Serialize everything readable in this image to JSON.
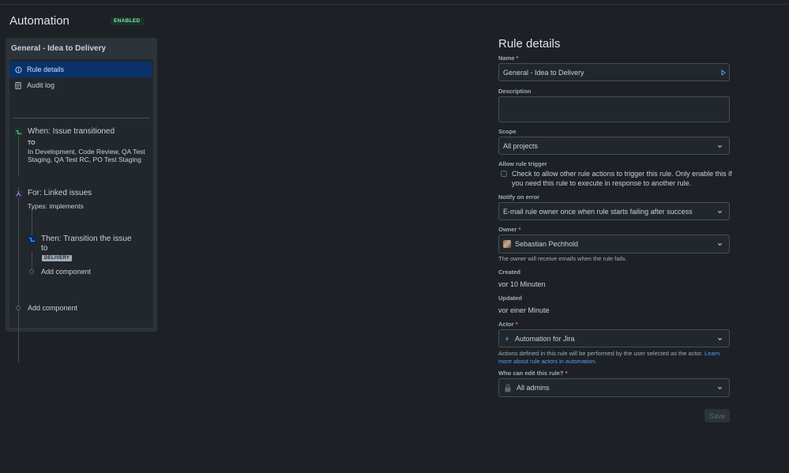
{
  "header": {
    "title": "Automation",
    "status_badge": "ENABLED"
  },
  "rule_panel": {
    "rule_name": "General - Idea to Delivery",
    "nav": {
      "rule_details": "Rule details",
      "audit_log": "Audit log"
    },
    "trigger": {
      "title": "When: Issue transitioned",
      "to_label": "TO",
      "statuses": "In Development, Code Review, QA Test Staging, QA Test RC, PO Test Staging"
    },
    "branch": {
      "title": "For: Linked issues",
      "types": "Types: implements"
    },
    "action": {
      "title": "Then: Transition the issue to",
      "status": "DELIVERY"
    },
    "add_component_inner": "Add component",
    "add_component_outer": "Add component"
  },
  "form": {
    "title": "Rule details",
    "name": {
      "label": "Name",
      "value": "General - Idea to Delivery"
    },
    "description": {
      "label": "Description",
      "value": ""
    },
    "scope": {
      "label": "Scope",
      "value": "All projects"
    },
    "allow_trigger": {
      "label": "Allow rule trigger",
      "text": "Check to allow other rule actions to trigger this rule. Only enable this if you need this rule to execute in response to another rule.",
      "checked": false
    },
    "notify": {
      "label": "Notify on error",
      "value": "E-mail rule owner once when rule starts failing after success"
    },
    "owner": {
      "label": "Owner",
      "value": "Sebastian Pechhold",
      "help": "The owner will receive emails when the rule fails."
    },
    "created": {
      "label": "Created",
      "value": "vor 10 Minuten"
    },
    "updated": {
      "label": "Updated",
      "value": "vor einer Minute"
    },
    "actor": {
      "label": "Actor",
      "value": "Automation for Jira",
      "help": "Actions defined in this rule will be performed by the user selected as the actor.",
      "help_link": "Learn more about rule actors in automation."
    },
    "edit_permission": {
      "label": "Who can edit this rule?",
      "value": "All admins"
    },
    "save_label": "Save"
  },
  "colors": {
    "background": "#1d2125",
    "active_nav": "#09326c",
    "badge_green": "#7ee2b8",
    "link": "#579dff",
    "required": "#f87168"
  },
  "icons": {
    "rule_details": "info-circle-icon",
    "audit_log": "document-icon",
    "trigger": "transition-icon",
    "branch": "branch-icon",
    "action": "transition-icon",
    "chevron": "chevron-down-icon",
    "lock": "lock-icon"
  }
}
